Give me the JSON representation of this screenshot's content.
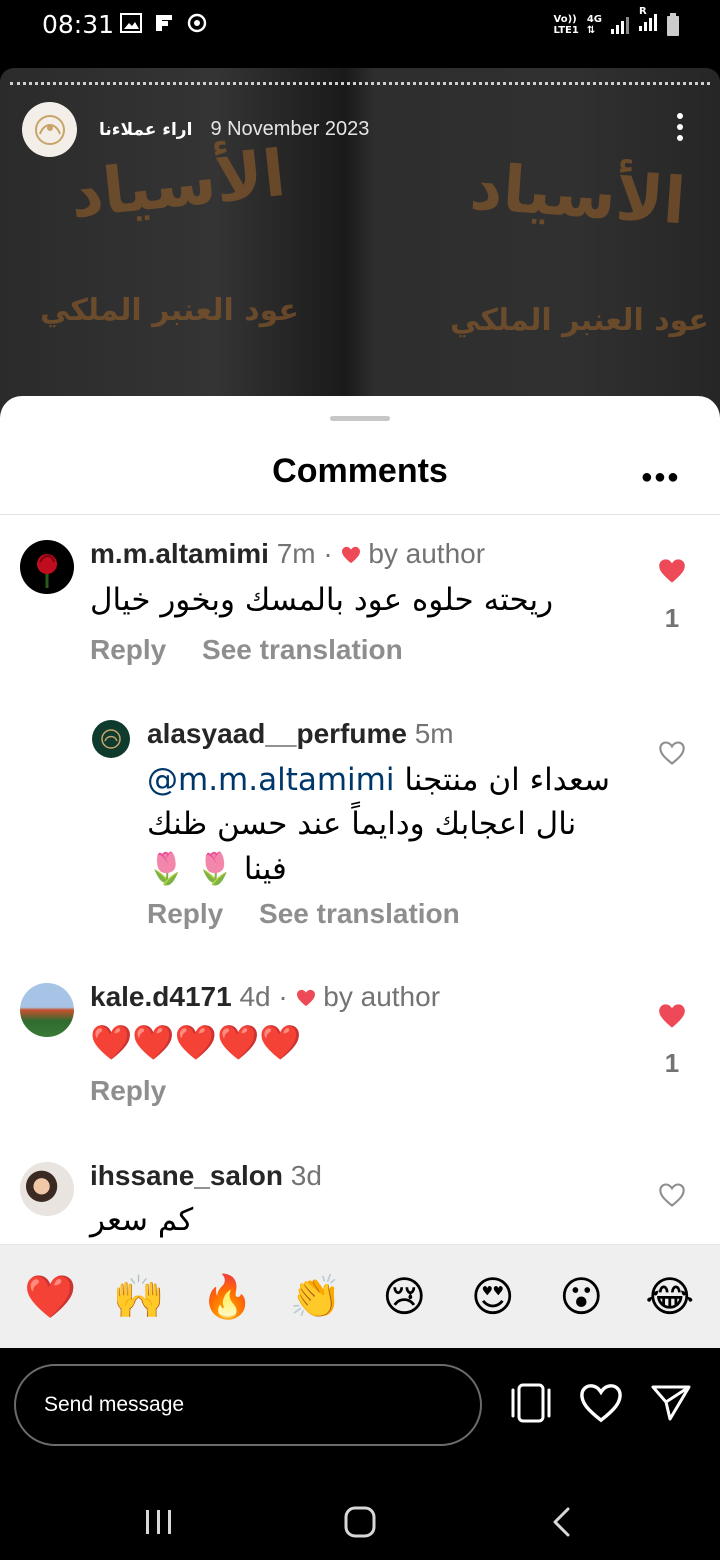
{
  "status_bar": {
    "time": "08:31",
    "network_top": "Vo))",
    "network_bottom": "LTE1",
    "net_type": "4G",
    "roaming": "R"
  },
  "story": {
    "username": "اراء عملاءنا",
    "date": "9 November 2023",
    "bg_text_1": "الأسياد",
    "bg_text_2": "عود العنبر الملكي"
  },
  "comments_sheet": {
    "title": "Comments",
    "comments": [
      {
        "username": "m.m.altamimi",
        "time": "7m",
        "separator": "·",
        "liked_by_author": "by author",
        "text": "ريحته حلوه عود بالمسك وبخور خيال",
        "reply": "Reply",
        "see_translation": "See translation",
        "likes": "1",
        "liked": true
      },
      {
        "username": "alasyaad__perfume",
        "time": "5m",
        "mention": "@m.m.altamimi",
        "text_line1": "سعداء ان منتجنا",
        "text_line2": "نال اعجابك ودايماً عند حسن ظنك",
        "text_line3": "فينا 🌷 🌷",
        "reply": "Reply",
        "see_translation": "See translation",
        "liked": false
      },
      {
        "username": "kale.d4171",
        "time": "4d",
        "separator": "·",
        "liked_by_author": "by author",
        "text": "❤️❤️❤️❤️❤️",
        "reply": "Reply",
        "likes": "1",
        "liked": true
      },
      {
        "username": "ihssane_salon",
        "time": "3d",
        "text": "كم سعر",
        "liked": false
      }
    ],
    "emoji_reactions": [
      "❤️",
      "🙌",
      "🔥",
      "👏",
      "😢",
      "😍",
      "😮",
      "😂"
    ]
  },
  "bottom_bar": {
    "send_placeholder": "Send message"
  },
  "colors": {
    "like_red": "#ed4956",
    "muted": "#737373",
    "mention": "#00376b"
  }
}
